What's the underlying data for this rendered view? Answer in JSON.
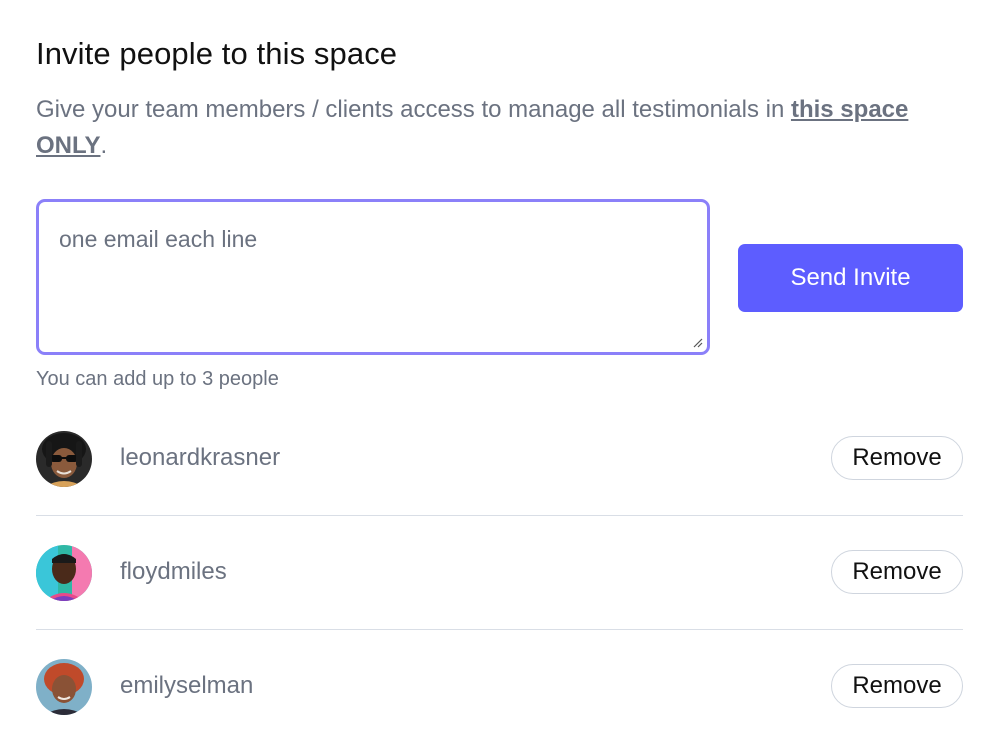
{
  "header": {
    "title": "Invite people to this space",
    "subtitle_prefix": "Give your team members / clients access to manage all testimonials in ",
    "subtitle_emphasis": "this space ONLY",
    "subtitle_suffix": "."
  },
  "invite": {
    "email_placeholder": "one email each line",
    "send_label": "Send Invite",
    "hint": "You can add up to 3 people"
  },
  "members": [
    {
      "username": "leonardkrasner",
      "remove_label": "Remove"
    },
    {
      "username": "floydmiles",
      "remove_label": "Remove"
    },
    {
      "username": "emilyselman",
      "remove_label": "Remove"
    }
  ],
  "colors": {
    "accent": "#5d5dff",
    "focus_border": "#8b80f9",
    "muted_text": "#6b7280",
    "divider": "#d9dee6"
  }
}
